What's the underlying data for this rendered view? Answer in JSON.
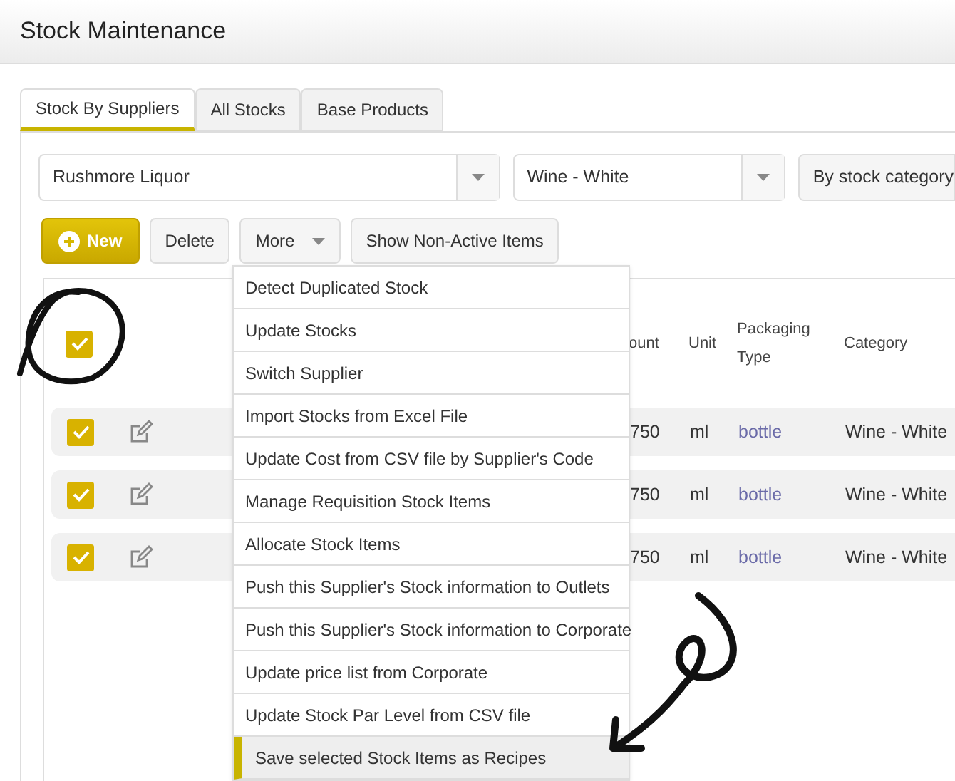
{
  "title": "Stock Maintenance",
  "tabs": [
    {
      "label": "Stock By Suppliers",
      "selected": true
    },
    {
      "label": "All Stocks",
      "selected": false
    },
    {
      "label": "Base Products",
      "selected": false
    }
  ],
  "filters": {
    "supplier": "Rushmore Liquor",
    "category": "Wine - White",
    "mode_button": "By stock category"
  },
  "toolbar": [
    {
      "label": "New",
      "kind": "primary"
    },
    {
      "label": "Delete",
      "kind": "plain"
    },
    {
      "label": "More",
      "kind": "dropdown"
    },
    {
      "label": "Show Non-Active Items",
      "kind": "plain"
    }
  ],
  "table": {
    "select_all_checked": true,
    "columns": [
      {
        "label": "ount"
      },
      {
        "label": "Unit"
      },
      {
        "label": "Packaging Type"
      },
      {
        "label": "Category"
      }
    ],
    "rows": [
      {
        "checked": true,
        "amount": "750",
        "unit": "ml",
        "packaging": "bottle",
        "category": "Wine - White"
      },
      {
        "checked": true,
        "amount": "750",
        "unit": "ml",
        "packaging": "bottle",
        "category": "Wine - White"
      },
      {
        "checked": true,
        "amount": "750",
        "unit": "ml",
        "packaging": "bottle",
        "category": "Wine - White"
      }
    ]
  },
  "more_menu": [
    {
      "label": "Detect Duplicated Stock",
      "selected": false
    },
    {
      "label": "Update Stocks",
      "selected": false
    },
    {
      "label": "Switch Supplier",
      "selected": false
    },
    {
      "label": "Import Stocks from Excel File",
      "selected": false
    },
    {
      "label": "Update Cost from CSV file by Supplier's Code",
      "selected": false
    },
    {
      "label": "Manage Requisition Stock Items",
      "selected": false
    },
    {
      "label": "Allocate Stock Items",
      "selected": false
    },
    {
      "label": "Push this Supplier's Stock information to Outlets",
      "selected": false
    },
    {
      "label": "Push this Supplier's Stock information to Corporate",
      "selected": false
    },
    {
      "label": "Update price list from Corporate",
      "selected": false
    },
    {
      "label": "Update Stock Par Level from CSV file",
      "selected": false
    },
    {
      "label": "Save selected Stock Items as Recipes",
      "selected": true
    }
  ]
}
